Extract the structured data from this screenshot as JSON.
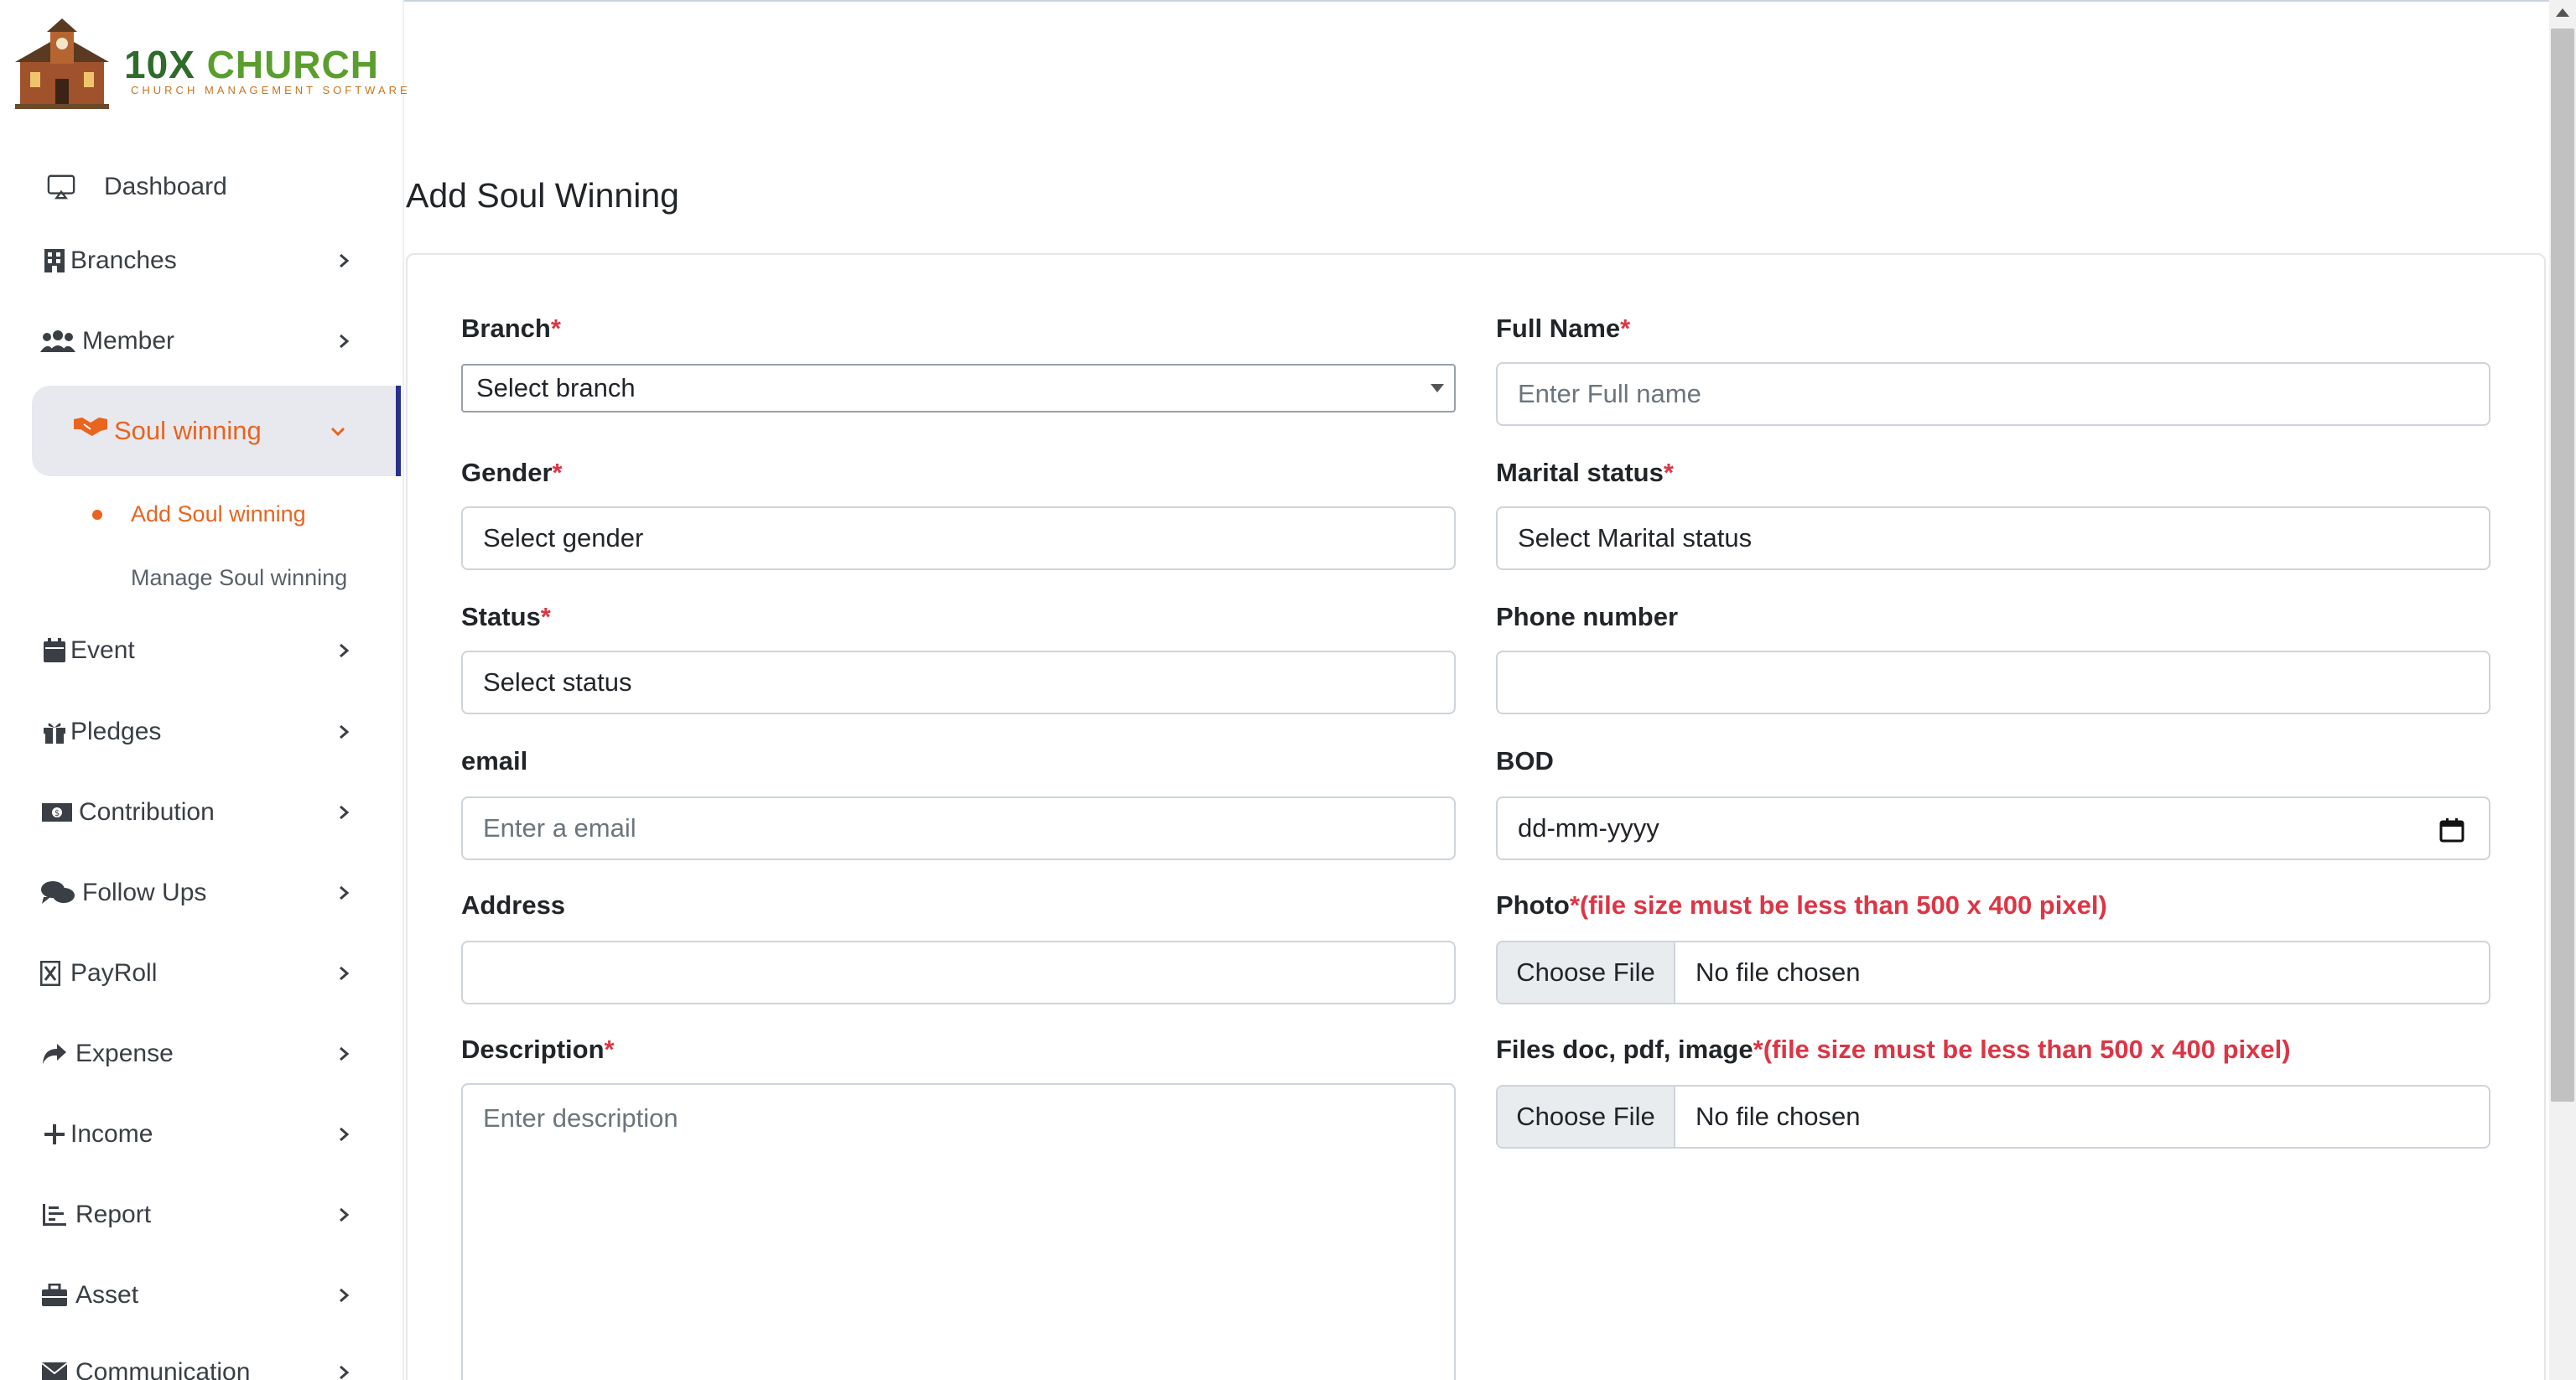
{
  "brand": {
    "name_part1": "10X",
    "name_part2": "CHURCH",
    "tagline": "CHURCH MANAGEMENT SOFTWARE"
  },
  "sidebar": {
    "items": [
      {
        "label": "Dashboard",
        "icon": "monitor-icon"
      },
      {
        "label": "Branches",
        "icon": "building-icon"
      },
      {
        "label": "Member",
        "icon": "users-icon"
      },
      {
        "label": "Soul winning",
        "icon": "handshake-icon",
        "active": true
      },
      {
        "label": "Event",
        "icon": "calendar-icon"
      },
      {
        "label": "Pledges",
        "icon": "gift-icon"
      },
      {
        "label": "Contribution",
        "icon": "money-icon"
      },
      {
        "label": "Follow Ups",
        "icon": "comments-icon"
      },
      {
        "label": "PayRoll",
        "icon": "file-invoice-icon"
      },
      {
        "label": "Expense",
        "icon": "share-icon"
      },
      {
        "label": "Income",
        "icon": "plus-icon"
      },
      {
        "label": "Report",
        "icon": "chart-icon"
      },
      {
        "label": "Asset",
        "icon": "briefcase-icon"
      },
      {
        "label": "Communication",
        "icon": "envelope-icon"
      }
    ],
    "sub_items": [
      {
        "label": "Add Soul winning",
        "active": true
      },
      {
        "label": "Manage Soul winning",
        "active": false
      }
    ],
    "active_color": "#e9641f",
    "active_border_color": "#28318a"
  },
  "page": {
    "title": "Add Soul Winning"
  },
  "form": {
    "branch": {
      "label": "Branch",
      "required": "*",
      "value": "Select branch"
    },
    "full_name": {
      "label": "Full Name",
      "required": "*",
      "placeholder": "Enter Full name"
    },
    "gender": {
      "label": "Gender",
      "required": "*",
      "value": "Select gender"
    },
    "marital_status": {
      "label": "Marital status",
      "required": "*",
      "value": "Select Marital status"
    },
    "status": {
      "label": "Status",
      "required": "*",
      "value": "Select status"
    },
    "phone": {
      "label": "Phone number",
      "value": ""
    },
    "email": {
      "label": "email",
      "placeholder": "Enter a email"
    },
    "bod": {
      "label": "BOD",
      "placeholder": "dd-mm-yyyy"
    },
    "address": {
      "label": "Address",
      "value": ""
    },
    "photo": {
      "label": "Photo",
      "required": "*",
      "hint": "(file size must be less than 500 x 400 pixel)",
      "button": "Choose File",
      "status": "No file chosen"
    },
    "description": {
      "label": "Description",
      "required": "*",
      "placeholder": "Enter description"
    },
    "files": {
      "label": "Files doc, pdf, image",
      "required": "*",
      "hint": "(file size must be less than 500 x 400 pixel)",
      "button": "Choose File",
      "status": "No file chosen"
    }
  }
}
